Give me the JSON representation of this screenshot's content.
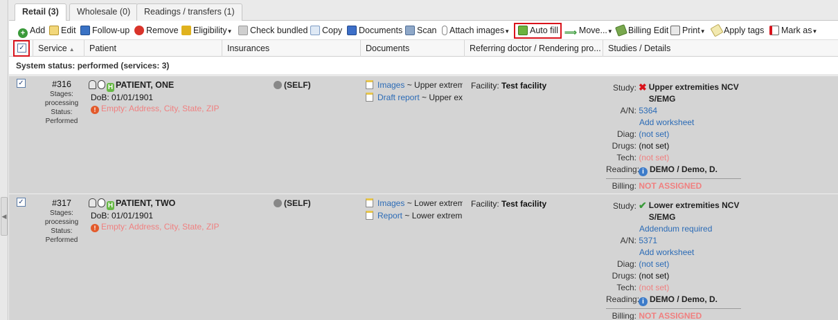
{
  "tabs": [
    {
      "label": "Retail (3)"
    },
    {
      "label": "Wholesale (0)"
    },
    {
      "label": "Readings / transfers (1)"
    }
  ],
  "toolbar": {
    "add": "Add",
    "edit": "Edit",
    "follow_up": "Follow-up",
    "remove": "Remove",
    "eligibility": "Eligibility",
    "check_bundled": "Check bundled",
    "copy": "Copy",
    "documents": "Documents",
    "scan": "Scan",
    "attach_images": "Attach images",
    "auto_fill": "Auto fill",
    "move": "Move...",
    "billing_edit": "Billing Edit",
    "print": "Print",
    "apply_tags": "Apply tags",
    "mark_as": "Mark as"
  },
  "columns": {
    "service": "Service",
    "patient": "Patient",
    "insurances": "Insurances",
    "documents": "Documents",
    "referring": "Referring doctor / Rendering pro...",
    "studies": "Studies / Details"
  },
  "group_label": "System status: performed (services: 3)",
  "rows": [
    {
      "id": "#316",
      "stages_label": "Stages:",
      "stage": "processing",
      "status_label": "Status:",
      "status": "Performed",
      "patient_name": "PATIENT, ONE",
      "dob": "DoB: 01/01/1901",
      "warning": "Empty: Address, City, State, ZIP",
      "insurance": "(SELF)",
      "doc1_link": "Images",
      "doc1_text": " ~ Upper extrem",
      "doc2_link": "Draft report",
      "doc2_text": " ~ Upper ex",
      "facility_label": "Facility:",
      "facility": "Test facility",
      "study_label": "Study:",
      "study": "Upper extremities NCV S/EMG",
      "an_label": "A/N:",
      "an": "5364",
      "add_worksheet": "Add worksheet",
      "diag_label": "Diag:",
      "diag": "(not set)",
      "drugs_label": "Drugs:",
      "drugs": "(not set)",
      "tech_label": "Tech:",
      "tech": "(not set)",
      "reading_label": "Reading:",
      "reading": "DEMO / Demo, D.",
      "billing_label": "Billing:",
      "billing": "NOT ASSIGNED"
    },
    {
      "id": "#317",
      "stages_label": "Stages:",
      "stage": "processing",
      "status_label": "Status:",
      "status": "Performed",
      "patient_name": "PATIENT, TWO",
      "dob": "DoB: 01/01/1901",
      "warning": "Empty: Address, City, State, ZIP",
      "insurance": "(SELF)",
      "doc1_link": "Images",
      "doc1_text": " ~ Lower extrem",
      "doc2_link": "Report",
      "doc2_text": " ~ Lower extrem",
      "facility_label": "Facility:",
      "facility": "Test facility",
      "study_label": "Study:",
      "study": "Lower extremities NCV S/EMG",
      "addendum": "Addendum required",
      "an_label": "A/N:",
      "an": "5371",
      "add_worksheet": "Add worksheet",
      "diag_label": "Diag:",
      "diag": "(not set)",
      "drugs_label": "Drugs:",
      "drugs": "(not set)",
      "tech_label": "Tech:",
      "tech": "(not set)",
      "reading_label": "Reading:",
      "reading": "DEMO / Demo, D.",
      "billing_label": "Billing:",
      "billing": "NOT ASSIGNED"
    }
  ],
  "colors": {
    "highlight_border": "#d9121b",
    "row_bg": "#d4d4d4",
    "link": "#2b6bb6",
    "warning_text": "#f08080"
  },
  "icons": [
    "add-icon",
    "edit-icon",
    "follow-up-icon",
    "remove-icon",
    "eligibility-icon",
    "check-bundled-icon",
    "copy-icon",
    "documents-icon",
    "scan-icon",
    "attach-icon",
    "auto-fill-icon",
    "move-icon",
    "billing-edit-icon",
    "print-icon",
    "tags-icon",
    "mark-icon"
  ]
}
